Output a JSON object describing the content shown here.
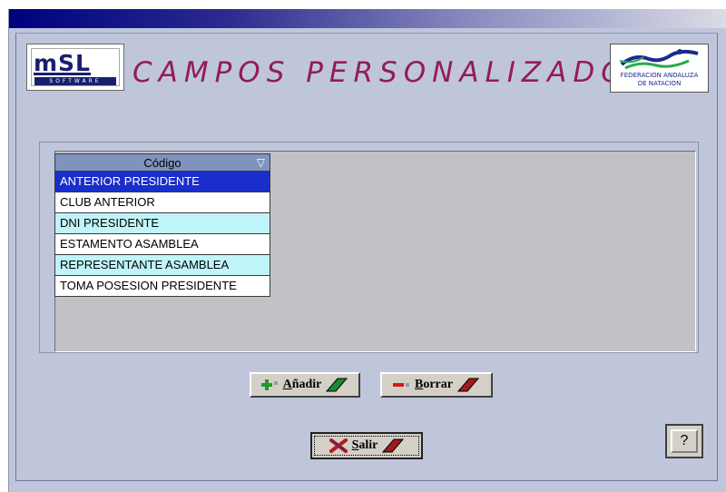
{
  "logo_msl": {
    "word": "mSL",
    "subtitle": "SOFTWARE"
  },
  "title": "CAMPOS PERSONALIZADOS",
  "logo_fan": {
    "line1": "FEDERACION ANDALUZA",
    "line2": "DE NATACION"
  },
  "list": {
    "header": "Código",
    "sort_icon": "▽",
    "items": [
      "ANTERIOR PRESIDENTE",
      "CLUB ANTERIOR",
      "DNI PRESIDENTE",
      "ESTAMENTO ASAMBLEA",
      "REPRESENTANTE ASAMBLEA",
      "TOMA POSESION PRESIDENTE"
    ],
    "selected_index": 0
  },
  "buttons": {
    "add": {
      "first": "A",
      "rest": "ñadir"
    },
    "delete": {
      "first": "B",
      "rest": "orrar"
    },
    "exit": {
      "first": "S",
      "rest": "alir"
    },
    "help": "?"
  },
  "colors": {
    "title": "#951a5b",
    "selected_row": "#1a2ecb",
    "alt_row": "#bff4f8",
    "window_bg": "#bfc6dc"
  }
}
